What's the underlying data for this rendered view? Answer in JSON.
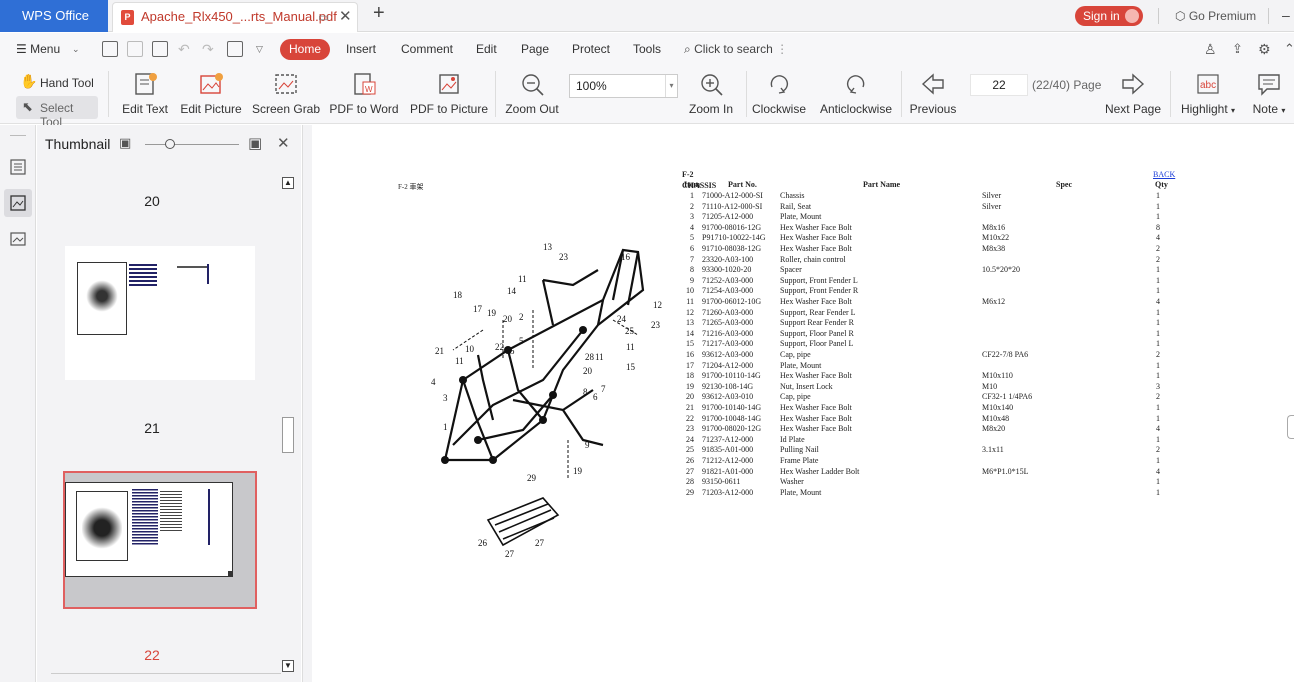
{
  "titlebar": {
    "app_tab": "WPS Office",
    "doc_tab": "Apache_Rlx450_...rts_Manual.pdf",
    "sign_in": "Sign in",
    "go_premium": "Go Premium"
  },
  "menu": {
    "menu_label": "Menu",
    "tabs": [
      "Home",
      "Insert",
      "Comment",
      "Edit",
      "Page",
      "Protect",
      "Tools"
    ],
    "search": "Click to search"
  },
  "toolbar": {
    "hand_tool": "Hand Tool",
    "select_tool": "Select Tool",
    "edit_text": "Edit Text",
    "edit_picture": "Edit Picture",
    "screen_grab": "Screen Grab",
    "pdf_to_word": "PDF to Word",
    "pdf_to_picture": "PDF to Picture",
    "zoom_out": "Zoom Out",
    "zoom_value": "100%",
    "zoom_in": "Zoom In",
    "clockwise": "Clockwise",
    "anticlockwise": "Anticlockwise",
    "previous": "Previous",
    "page_input": "22",
    "page_total": "(22/40) Page",
    "next_page": "Next Page",
    "highlight": "Highlight",
    "note": "Note"
  },
  "thumbnail": {
    "title": "Thumbnail",
    "pages": [
      "20",
      "21",
      "22"
    ]
  },
  "document": {
    "section_title": "F-2 CHASSIS",
    "chinese_label": "F-2 車架",
    "back_link": "BACK",
    "headers": {
      "item": "Item",
      "part_no": "Part No.",
      "part_name": "Part Name",
      "spec": "Spec",
      "qty": "Qty"
    },
    "parts": [
      {
        "item": "1",
        "no": "71000-A12-000-SI",
        "name": "Chassis",
        "spec": "Silver",
        "qty": "1"
      },
      {
        "item": "2",
        "no": "71110-A12-000-SI",
        "name": "Rail, Seat",
        "spec": "Silver",
        "qty": "1"
      },
      {
        "item": "3",
        "no": "71205-A12-000",
        "name": "Plate, Mount",
        "spec": "",
        "qty": "1"
      },
      {
        "item": "4",
        "no": "91700-08016-12G",
        "name": "Hex Washer Face Bolt",
        "spec": "M8x16",
        "qty": "8"
      },
      {
        "item": "5",
        "no": "P91710-10022-14G",
        "name": "Hex Washer Face Bolt",
        "spec": "M10x22",
        "qty": "4"
      },
      {
        "item": "6",
        "no": "91710-08038-12G",
        "name": "Hex Washer Face Bolt",
        "spec": "M8x38",
        "qty": "2"
      },
      {
        "item": "7",
        "no": "23320-A03-100",
        "name": "Roller, chain control",
        "spec": "",
        "qty": "2"
      },
      {
        "item": "8",
        "no": "93300-1020-20",
        "name": "Spacer",
        "spec": "10.5*20*20",
        "qty": "1"
      },
      {
        "item": "9",
        "no": "71252-A03-000",
        "name": "Support, Front Fender L",
        "spec": "",
        "qty": "1"
      },
      {
        "item": "10",
        "no": "71254-A03-000",
        "name": "Support, Front Fender R",
        "spec": "",
        "qty": "1"
      },
      {
        "item": "11",
        "no": "91700-06012-10G",
        "name": "Hex Washer Face Bolt",
        "spec": "M6x12",
        "qty": "4"
      },
      {
        "item": "12",
        "no": "71260-A03-000",
        "name": "Support, Rear Fender L",
        "spec": "",
        "qty": "1"
      },
      {
        "item": "13",
        "no": "71265-A03-000",
        "name": "Support Rear Fender R",
        "spec": "",
        "qty": "1"
      },
      {
        "item": "14",
        "no": "71216-A03-000",
        "name": "Support, Floor Panel R",
        "spec": "",
        "qty": "1"
      },
      {
        "item": "15",
        "no": "71217-A03-000",
        "name": "Support, Floor Panel L",
        "spec": "",
        "qty": "1"
      },
      {
        "item": "16",
        "no": "93612-A03-000",
        "name": "Cap, pipe",
        "spec": "CF22-7/8 PA6",
        "qty": "2"
      },
      {
        "item": "17",
        "no": "71204-A12-000",
        "name": "Plate, Mount",
        "spec": "",
        "qty": "1"
      },
      {
        "item": "18",
        "no": "91700-10110-14G",
        "name": "Hex Washer Face Bolt",
        "spec": "M10x110",
        "qty": "1"
      },
      {
        "item": "19",
        "no": "92130-108-14G",
        "name": "Nut, Insert Lock",
        "spec": "M10",
        "qty": "3"
      },
      {
        "item": "20",
        "no": "93612-A03-010",
        "name": "Cap, pipe",
        "spec": "CF32-1 1/4PA6",
        "qty": "2"
      },
      {
        "item": "21",
        "no": "91700-10140-14G",
        "name": "Hex Washer Face Bolt",
        "spec": "M10x140",
        "qty": "1"
      },
      {
        "item": "22",
        "no": "91700-10048-14G",
        "name": "Hex Washer Face Bolt",
        "spec": "M10x48",
        "qty": "1"
      },
      {
        "item": "23",
        "no": "91700-08020-12G",
        "name": "Hex Washer Face Bolt",
        "spec": "M8x20",
        "qty": "4"
      },
      {
        "item": "24",
        "no": "71237-A12-000",
        "name": "Id Plate",
        "spec": "",
        "qty": "1"
      },
      {
        "item": "25",
        "no": "91835-A01-000",
        "name": "Pulling Nail",
        "spec": "3.1x11",
        "qty": "2"
      },
      {
        "item": "26",
        "no": "71212-A12-000",
        "name": "Frame Plate",
        "spec": "",
        "qty": "1"
      },
      {
        "item": "27",
        "no": "91821-A01-000",
        "name": "Hex Washer Ladder Bolt",
        "spec": "M6*P1.0*15L",
        "qty": "4"
      },
      {
        "item": "28",
        "no": "93150-0611",
        "name": "Washer",
        "spec": "",
        "qty": "1"
      },
      {
        "item": "29",
        "no": "71203-A12-000",
        "name": "Plate, Mount",
        "spec": "",
        "qty": "1"
      }
    ],
    "callouts": [
      "13",
      "23",
      "16",
      "11",
      "14",
      "18",
      "17",
      "19",
      "20",
      "2",
      "12",
      "24",
      "25",
      "28",
      "11",
      "15",
      "21",
      "10",
      "22",
      "5",
      "5",
      "11",
      "4",
      "3",
      "1",
      "6",
      "7",
      "8",
      "9",
      "29",
      "19",
      "20",
      "26",
      "27",
      "27"
    ]
  },
  "colors": {
    "accent": "#d8453a",
    "wps_blue": "#2f6fd6",
    "panel": "#f3f3f5"
  }
}
